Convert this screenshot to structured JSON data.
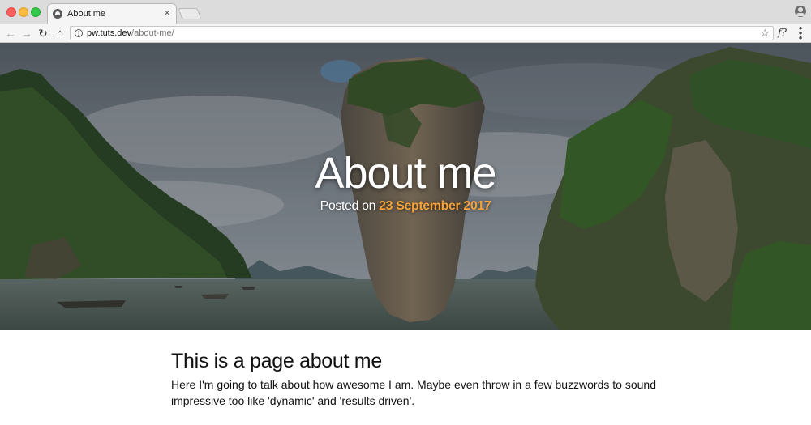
{
  "browser": {
    "tab_title": "About me",
    "tab_close": "×",
    "url_host": "pw.tuts.dev",
    "url_path": "/about-me/",
    "nav": {
      "back": "←",
      "forward": "→",
      "reload": "↻",
      "home": "⌂"
    },
    "info_glyph": "i",
    "star_glyph": "☆",
    "extension_label": "f?",
    "menu_glyph": "⋮",
    "icons": [
      "close-window",
      "minimize-window",
      "maximize-window",
      "page-favicon",
      "tab-close",
      "back-arrow",
      "forward-arrow",
      "reload",
      "home",
      "site-info",
      "bookmark-star",
      "extension",
      "menu",
      "profile"
    ]
  },
  "hero": {
    "title": "About me",
    "posted_prefix": "Posted on ",
    "date": "23 September 2017"
  },
  "content": {
    "heading": "This is a page about me",
    "body": "Here I'm going to talk about how awesome I am. Maybe even throw in a few buzzwords to sound impressive too like 'dynamic' and 'results driven'."
  },
  "colors": {
    "accent_date": "#f6a23a",
    "traffic_close": "#fc605c",
    "traffic_min": "#fdbc40",
    "traffic_max": "#34c84a"
  }
}
